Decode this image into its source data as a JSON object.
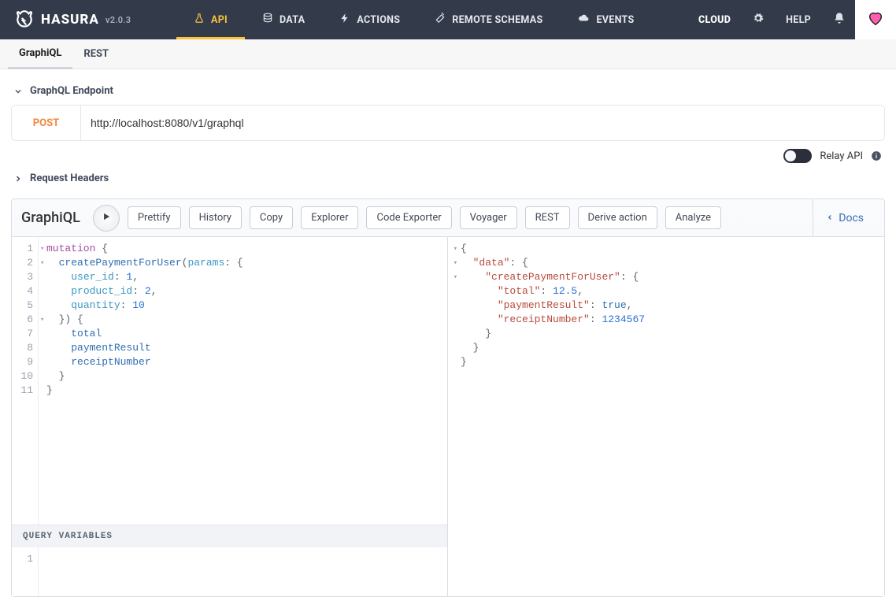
{
  "brand": {
    "name": "HASURA",
    "version": "v2.0.3"
  },
  "nav": {
    "items": [
      {
        "id": "api",
        "label": "API",
        "icon": "flask"
      },
      {
        "id": "data",
        "label": "DATA",
        "icon": "db"
      },
      {
        "id": "actions",
        "label": "ACTIONS",
        "icon": "bolt"
      },
      {
        "id": "remote-schemas",
        "label": "REMOTE SCHEMAS",
        "icon": "wand"
      },
      {
        "id": "events",
        "label": "EVENTS",
        "icon": "cloud"
      }
    ],
    "cloud_label": "CLOUD",
    "help_label": "HELP"
  },
  "subnav": {
    "graphiql": "GraphiQL",
    "rest": "REST"
  },
  "sections": {
    "endpoint_title": "GraphQL Endpoint",
    "headers_title": "Request Headers"
  },
  "endpoint": {
    "method": "POST",
    "url": "http://localhost:8080/v1/graphql"
  },
  "relay": {
    "label": "Relay API"
  },
  "graphiql": {
    "title": "GraphiQL",
    "buttons": {
      "prettify": "Prettify",
      "history": "History",
      "copy": "Copy",
      "explorer": "Explorer",
      "code_exporter": "Code Exporter",
      "voyager": "Voyager",
      "rest": "REST",
      "derive_action": "Derive action",
      "analyze": "Analyze"
    },
    "docs_label": "Docs"
  },
  "query_vars_label": "Query Variables",
  "query": {
    "raw": "mutation {\n  createPaymentForUser(params: {\n    user_id: 1,\n    product_id: 2,\n    quantity: 10\n  }) {\n    total\n    paymentResult\n    receiptNumber\n  }\n}",
    "tokens_html": [
      "<span class='tok-kw'>mutation</span> <span class='tok-brace'>{</span>",
      "  <span class='tok-fn'>createPaymentForUser</span><span class='tok-plain'>(</span><span class='tok-arg'>params</span><span class='tok-plain'>: {</span>",
      "    <span class='tok-arg'>user_id</span><span class='tok-plain'>: </span><span class='tok-num'>1</span><span class='tok-plain'>,</span>",
      "    <span class='tok-arg'>product_id</span><span class='tok-plain'>: </span><span class='tok-num'>2</span><span class='tok-plain'>,</span>",
      "    <span class='tok-arg'>quantity</span><span class='tok-plain'>: </span><span class='tok-num'>10</span>",
      "  <span class='tok-plain'>}) {</span>",
      "    <span class='tok-fn'>total</span>",
      "    <span class='tok-fn'>paymentResult</span>",
      "    <span class='tok-fn'>receiptNumber</span>",
      "  <span class='tok-brace'>}</span>",
      "<span class='tok-brace'>}</span>"
    ],
    "line_count": 11,
    "fold_lines": [
      1,
      2,
      6
    ]
  },
  "result": {
    "data": {
      "createPaymentForUser": {
        "total": 12.5,
        "paymentResult": true,
        "receiptNumber": 1234567
      }
    },
    "tokens_html": [
      "<span class='tok-brace'>{</span>",
      "  <span class='tok-str'>\"data\"</span><span class='tok-plain'>: {</span>",
      "    <span class='tok-str'>\"createPaymentForUser\"</span><span class='tok-plain'>: {</span>",
      "      <span class='tok-str'>\"total\"</span><span class='tok-plain'>: </span><span class='tok-num'>12.5</span><span class='tok-plain'>,</span>",
      "      <span class='tok-str'>\"paymentResult\"</span><span class='tok-plain'>: </span><span class='tok-bool'>true</span><span class='tok-plain'>,</span>",
      "      <span class='tok-str'>\"receiptNumber\"</span><span class='tok-plain'>: </span><span class='tok-num'>1234567</span>",
      "    <span class='tok-brace'>}</span>",
      "  <span class='tok-brace'>}</span>",
      "<span class='tok-brace'>}</span>"
    ],
    "fold_lines": [
      1,
      2,
      3
    ]
  }
}
